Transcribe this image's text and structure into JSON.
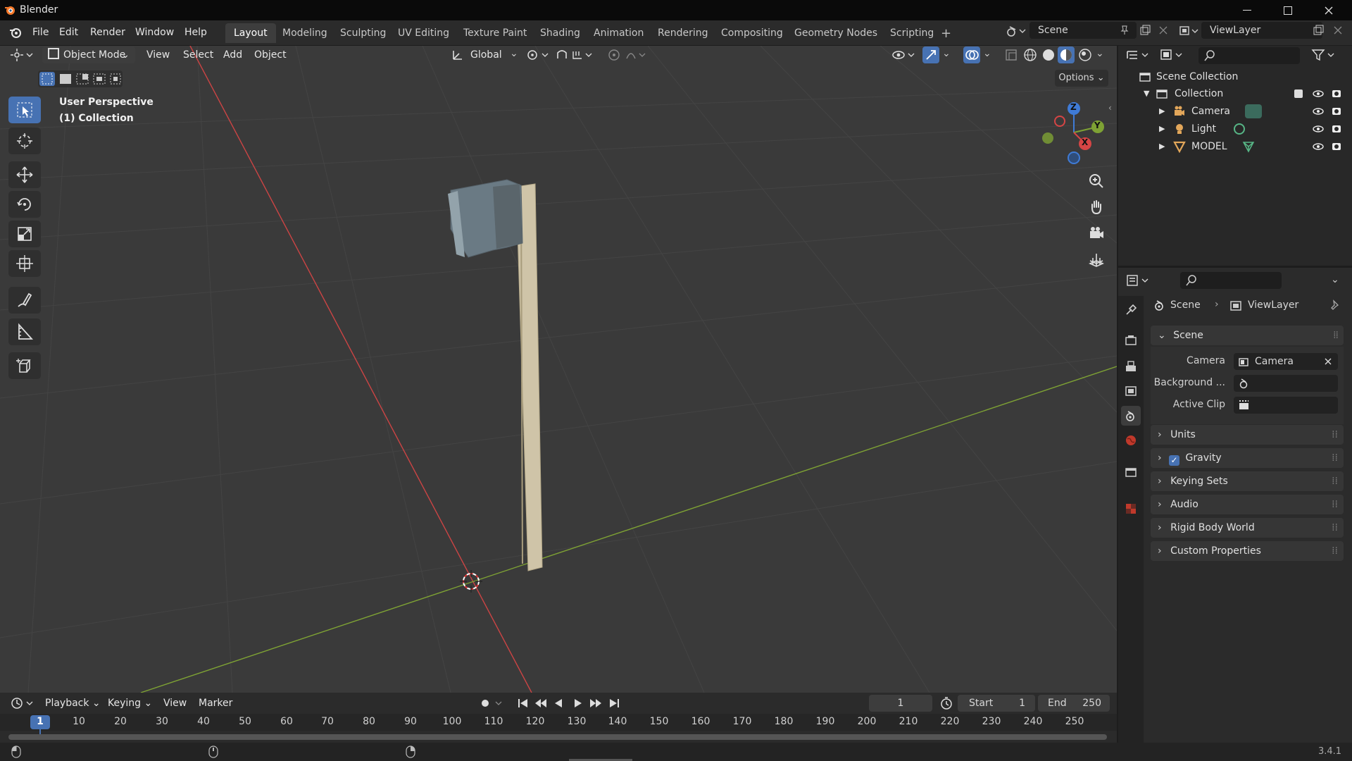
{
  "window": {
    "title": "Blender"
  },
  "menu": [
    "File",
    "Edit",
    "Render",
    "Window",
    "Help"
  ],
  "workspaces": [
    "Layout",
    "Modeling",
    "Sculpting",
    "UV Editing",
    "Texture Paint",
    "Shading",
    "Animation",
    "Rendering",
    "Compositing",
    "Geometry Nodes",
    "Scripting"
  ],
  "active_workspace": "Layout",
  "scene_name": "Scene",
  "view_layer_name": "ViewLayer",
  "viewport": {
    "mode": "Object Mode",
    "menus": [
      "View",
      "Select",
      "Add",
      "Object"
    ],
    "orientation": "Global",
    "options_label": "Options",
    "perspective": "User Perspective",
    "collection": "(1) Collection",
    "gizmo": {
      "x": "X",
      "y": "Y",
      "z": "Z"
    }
  },
  "outliner": {
    "root": "Scene Collection",
    "collection": "Collection",
    "items": [
      {
        "name": "Camera",
        "icon": "camera-icon",
        "color": "#e3a75a"
      },
      {
        "name": "Light",
        "icon": "light-icon",
        "color": "#e3a75a"
      },
      {
        "name": "MODEL",
        "icon": "mesh-icon",
        "color": "#e3a75a"
      }
    ]
  },
  "properties": {
    "breadcrumb": {
      "scene": "Scene",
      "view_layer": "ViewLayer"
    },
    "panel_title": "Scene",
    "fields": {
      "camera_label": "Camera",
      "camera_value": "Camera",
      "background_label": "Background ...",
      "active_clip_label": "Active Clip"
    },
    "sections": [
      {
        "label": "Units",
        "checkbox": false
      },
      {
        "label": "Gravity",
        "checkbox": true
      },
      {
        "label": "Keying Sets",
        "checkbox": false
      },
      {
        "label": "Audio",
        "checkbox": false
      },
      {
        "label": "Rigid Body World",
        "checkbox": false
      },
      {
        "label": "Custom Properties",
        "checkbox": false
      }
    ]
  },
  "timeline": {
    "menus": [
      "Playback",
      "Keying",
      "View",
      "Marker"
    ],
    "current_frame": "1",
    "start_label": "Start",
    "start_value": "1",
    "end_label": "End",
    "end_value": "250",
    "ruler": [
      "1",
      "10",
      "20",
      "30",
      "40",
      "50",
      "60",
      "70",
      "80",
      "90",
      "100",
      "110",
      "120",
      "130",
      "140",
      "150",
      "160",
      "170",
      "180",
      "190",
      "200",
      "210",
      "220",
      "230",
      "240",
      "250"
    ]
  },
  "statusbar": {
    "version": "3.4.1"
  },
  "colors": {
    "accent": "#4772b3",
    "x_axis": "#d64545",
    "y_axis": "#7ea234",
    "z_axis": "#3f7bd6"
  }
}
